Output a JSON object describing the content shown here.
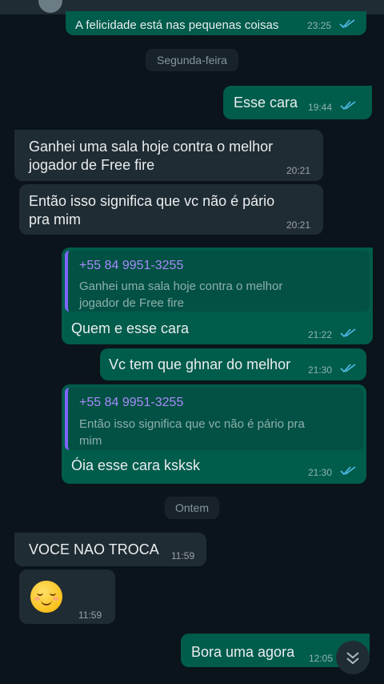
{
  "top_message": {
    "text": "A felicidade está nas pequenas coisas",
    "time": "23:25"
  },
  "days": {
    "monday": "Segunda-feira",
    "yesterday": "Ontem"
  },
  "messages": {
    "m1": {
      "text": "Esse cara",
      "time": "19:44"
    },
    "m2": {
      "line1": "Ganhei uma sala hoje contra o melhor",
      "line2": "jogador de Free fire",
      "time": "20:21"
    },
    "m3": {
      "line1": "Então isso significa que vc não é pário",
      "line2": "pra mim",
      "time": "20:21"
    },
    "m4": {
      "quote_author": "+55 84 9951-3255",
      "quote_line1": "Ganhei uma sala hoje contra o melhor",
      "quote_line2": "jogador de Free fire",
      "text": "Quem e esse cara",
      "time": "21:22"
    },
    "m5": {
      "text": "Vc tem que ghnar do melhor",
      "time": "21:30"
    },
    "m6": {
      "quote_author": "+55 84 9951-3255",
      "quote_line1": "Então isso significa que vc não é pário pra",
      "quote_line2": "mim",
      "text": "Óia esse cara ksksk",
      "time": "21:30"
    },
    "m7": {
      "text": "VOCE NAO TROCA",
      "time": "11:59"
    },
    "m8": {
      "emoji": "relieved-face",
      "time": "11:59"
    },
    "m9": {
      "text": "Bora uma agora",
      "time": "12:05"
    }
  },
  "colors": {
    "background": "#0b141a",
    "outgoing": "#005c4b",
    "incoming": "#202c33",
    "read_ticks": "#53bdeb",
    "quote_accent": "#7f66ff"
  }
}
